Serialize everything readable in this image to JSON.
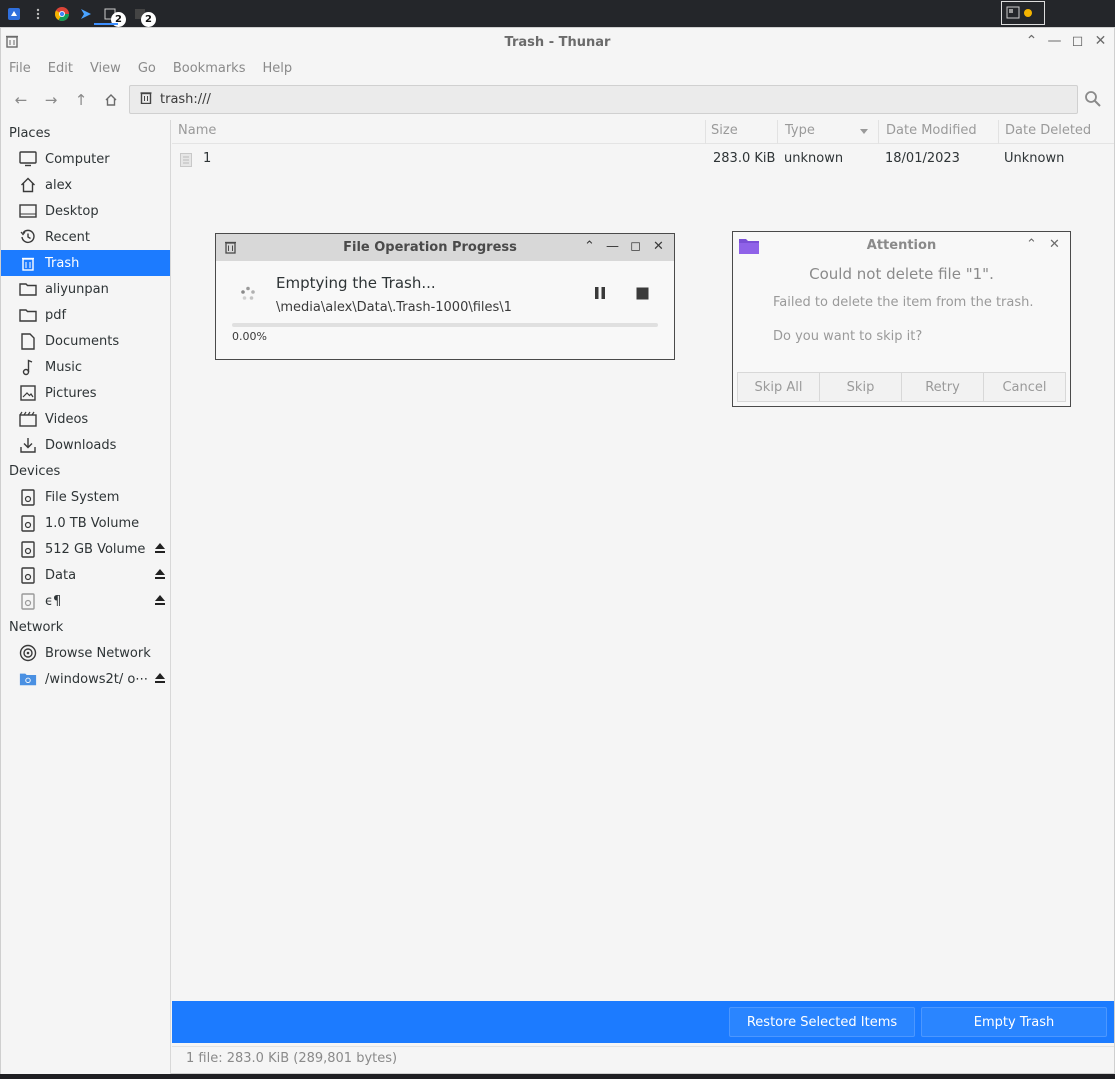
{
  "window": {
    "title": "Trash - Thunar"
  },
  "menubar": {
    "items": [
      "File",
      "Edit",
      "View",
      "Go",
      "Bookmarks",
      "Help"
    ]
  },
  "panel": {
    "badges": [
      "2",
      "2"
    ]
  },
  "location": {
    "path": "trash:///"
  },
  "sidebar": {
    "places_label": "Places",
    "places": [
      {
        "label": "Computer",
        "icon": "computer-icon"
      },
      {
        "label": "alex",
        "icon": "home-icon"
      },
      {
        "label": "Desktop",
        "icon": "desktop-icon"
      },
      {
        "label": "Recent",
        "icon": "recent-icon"
      },
      {
        "label": "Trash",
        "icon": "trash-icon",
        "selected": true
      },
      {
        "label": "aliyunpan",
        "icon": "folder-icon"
      },
      {
        "label": "pdf",
        "icon": "folder-icon"
      },
      {
        "label": "Documents",
        "icon": "document-icon"
      },
      {
        "label": "Music",
        "icon": "music-icon"
      },
      {
        "label": "Pictures",
        "icon": "pictures-icon"
      },
      {
        "label": "Videos",
        "icon": "videos-icon"
      },
      {
        "label": "Downloads",
        "icon": "downloads-icon"
      }
    ],
    "devices_label": "Devices",
    "devices": [
      {
        "label": "File System",
        "icon": "drive-icon",
        "eject": false
      },
      {
        "label": "1.0 TB Volume",
        "icon": "drive-icon",
        "eject": false
      },
      {
        "label": "512 GB Volume",
        "icon": "drive-icon",
        "eject": true
      },
      {
        "label": "Data",
        "icon": "drive-icon",
        "eject": true
      },
      {
        "label": "ϵ¶",
        "icon": "drive-icon",
        "eject": true
      }
    ],
    "network_label": "Network",
    "network": [
      {
        "label": "Browse Network",
        "icon": "network-icon",
        "eject": false
      },
      {
        "label": "/windows2t/ o⋯",
        "icon": "network-share-icon",
        "eject": true
      }
    ]
  },
  "columns": {
    "name": "Name",
    "size": "Size",
    "type": "Type",
    "date_modified": "Date Modified",
    "date_deleted": "Date Deleted"
  },
  "files": [
    {
      "name": "1",
      "size": "283.0 KiB",
      "type": "unknown",
      "date_modified": "18/01/2023",
      "date_deleted": "Unknown"
    }
  ],
  "trashbar": {
    "restore_label": "Restore Selected Items",
    "empty_label": "Empty Trash",
    "accent": "#1c7bff"
  },
  "statusbar": {
    "text": "1 file: 283.0 KiB (289,801 bytes)"
  },
  "progress_dialog": {
    "title": "File Operation Progress",
    "operation": "Emptying the Trash...",
    "path": "\\media\\alex\\Data\\.Trash-1000\\files\\1",
    "percent_label": "0.00%",
    "progress": 0.0
  },
  "attention_dialog": {
    "title": "Attention",
    "heading": "Could not delete file \"1\".",
    "message": "Failed to delete the item from the trash.",
    "question": "Do you want to skip it?",
    "buttons": [
      "Skip All",
      "Skip",
      "Retry",
      "Cancel"
    ]
  }
}
